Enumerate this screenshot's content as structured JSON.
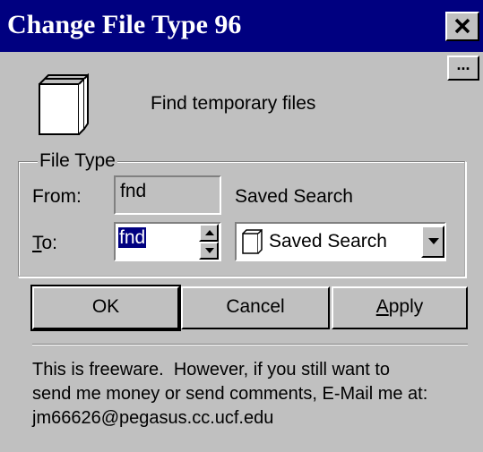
{
  "window": {
    "title": "Change File Type 96"
  },
  "buttons": {
    "more": "..."
  },
  "description": "Find temporary files",
  "group": {
    "legend": "File Type",
    "from_label": "From:",
    "from_value": "fnd",
    "from_type": "Saved Search",
    "to_label_rest": "o:",
    "to_label_accel": "T",
    "to_value": "fnd",
    "to_type_selected": "Saved Search"
  },
  "actions": {
    "ok": "OK",
    "cancel": "Cancel",
    "apply_accel": "A",
    "apply_rest": "pply"
  },
  "footer": {
    "line1": "This is freeware.  However, if you still want to",
    "line2": "send me money or send comments, E-Mail me at:",
    "line3": "jm66626@pegasus.cc.ucf.edu"
  },
  "colors": {
    "titlebar": "#000080",
    "face": "#c0c0c0",
    "selection": "#000080"
  }
}
